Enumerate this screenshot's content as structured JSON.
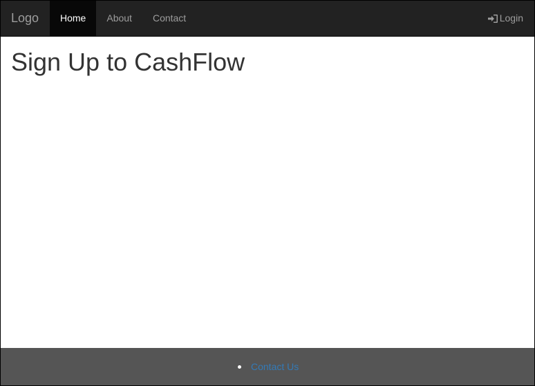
{
  "navbar": {
    "brand": "Logo",
    "items": [
      {
        "label": "Home",
        "active": true
      },
      {
        "label": "About",
        "active": false
      },
      {
        "label": "Contact",
        "active": false
      }
    ],
    "login": {
      "icon": "log-in-icon",
      "label": "Login"
    }
  },
  "main": {
    "title": "Sign Up to CashFlow"
  },
  "footer": {
    "links": [
      {
        "label": "Contact Us"
      }
    ]
  },
  "colors": {
    "navbar_bg": "#222222",
    "active_item_bg": "#080808",
    "footer_bg": "#555555",
    "link": "#337ab7"
  }
}
